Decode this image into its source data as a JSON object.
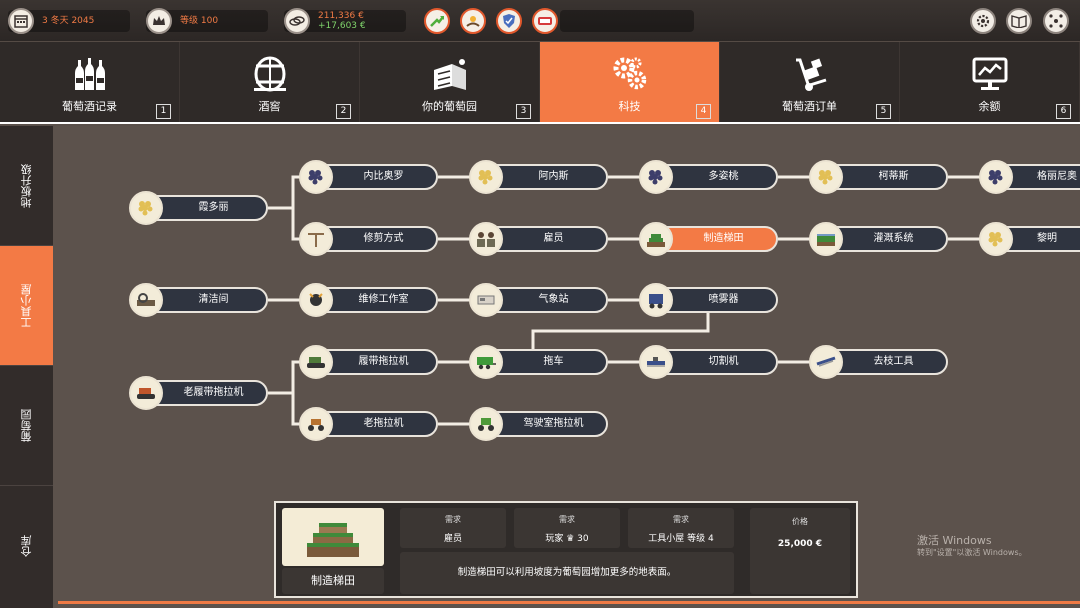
{
  "status": {
    "date": "3 冬天 2045",
    "level": "等级 100",
    "money": "211,336 €",
    "income": "+17,603 €"
  },
  "icons": {
    "calendar": "calendar-icon",
    "crown": "crown-icon",
    "coin": "coins-icon",
    "settings": "gear-icon",
    "book": "book-icon",
    "network": "network-icon"
  },
  "tabs": [
    {
      "label": "葡萄酒记录",
      "key": "1"
    },
    {
      "label": "酒窖",
      "key": "2"
    },
    {
      "label": "你的葡萄园",
      "key": "3"
    },
    {
      "label": "科技",
      "key": "4"
    },
    {
      "label": "葡萄酒订单",
      "key": "5"
    },
    {
      "label": "余额",
      "key": "6"
    }
  ],
  "side_tabs": [
    "地板升级",
    "工具小屋",
    "葡萄园",
    "仓库"
  ],
  "tree": {
    "nodes": [
      {
        "id": "xia",
        "label": "霞多丽"
      },
      {
        "id": "neb",
        "label": "内比奥罗"
      },
      {
        "id": "arn",
        "label": "阿内斯"
      },
      {
        "id": "dol",
        "label": "多姿桃"
      },
      {
        "id": "cor",
        "label": "柯蒂斯"
      },
      {
        "id": "gre",
        "label": "格丽尼奥"
      },
      {
        "id": "pru",
        "label": "修剪方式"
      },
      {
        "id": "emp",
        "label": "雇员"
      },
      {
        "id": "ter",
        "label": "制造梯田"
      },
      {
        "id": "irr",
        "label": "灌溉系统"
      },
      {
        "id": "li",
        "label": "黎明"
      },
      {
        "id": "cle",
        "label": "清洁间"
      },
      {
        "id": "rep",
        "label": "维修工作室"
      },
      {
        "id": "wea",
        "label": "气象站"
      },
      {
        "id": "spr",
        "label": "喷雾器"
      },
      {
        "id": "oct",
        "label": "老履带拖拉机"
      },
      {
        "id": "crt",
        "label": "履带拖拉机"
      },
      {
        "id": "trl",
        "label": "拖车"
      },
      {
        "id": "cut",
        "label": "切割机"
      },
      {
        "id": "deb",
        "label": "去枝工具"
      },
      {
        "id": "otr",
        "label": "老拖拉机"
      },
      {
        "id": "cab",
        "label": "驾驶室拖拉机"
      }
    ]
  },
  "detail": {
    "name": "制造梯田",
    "req1_title": "需求",
    "req1_value": "雇员",
    "req2_title": "需求",
    "req2_value": "玩家 ♛ 30",
    "req3_title": "需求",
    "req3_value": "工具小屋 等级 4",
    "price_title": "价格",
    "price_value": "25,000 €",
    "description": "制造梯田可以利用坡度为葡萄园增加更多的地表面。"
  },
  "watermark": {
    "line1": "激活 Windows",
    "line2": "转到\"设置\"以激活 Windows。"
  },
  "colors": {
    "accent": "#f37a45",
    "node_bg": "#2f3440",
    "panel_bg": "#5c524c"
  }
}
